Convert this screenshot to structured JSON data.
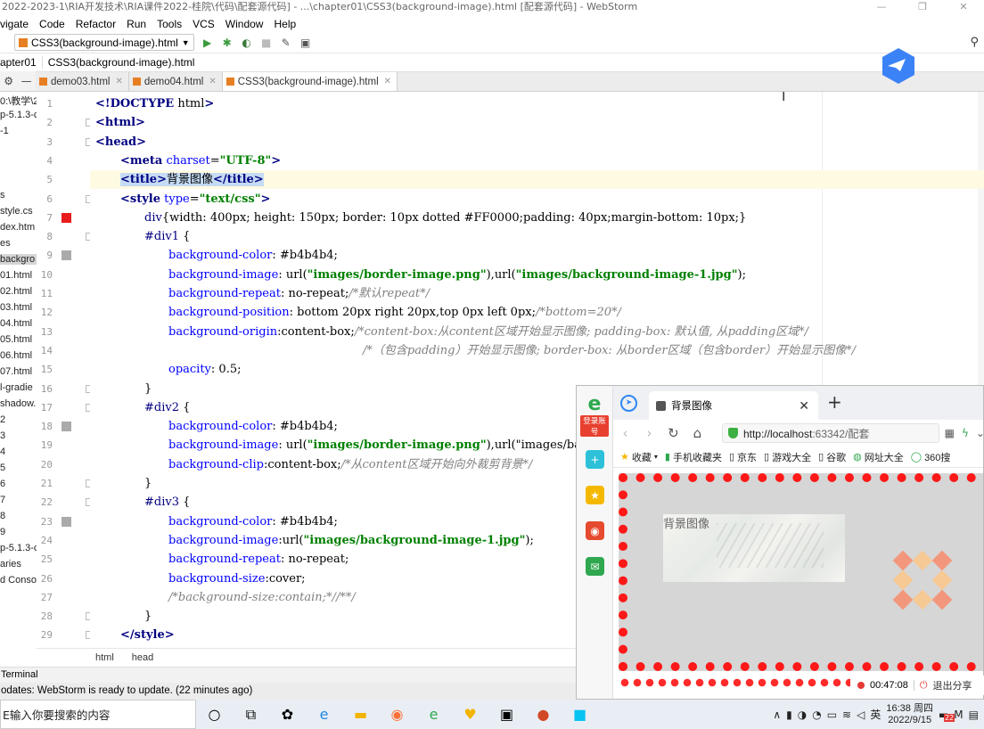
{
  "window": {
    "title": "2022-2023-1\\RIA开发技术\\RIA课件2022-桂院\\代码\\配套源代码] - ...\\chapter01\\CSS3(background-image).html [配套源代码] - WebStorm"
  },
  "menu": [
    "vigate",
    "Code",
    "Refactor",
    "Run",
    "Tools",
    "VCS",
    "Window",
    "Help"
  ],
  "toolbar": {
    "run_config": "CSS3(background-image).html"
  },
  "nav": {
    "crumb1": "apter01",
    "crumb2": "CSS3(background-image).html"
  },
  "editor_tabs": [
    {
      "label": "demo03.html"
    },
    {
      "label": "demo04.html"
    },
    {
      "label": "CSS3(background-image).html"
    }
  ],
  "project_tree": [
    "0:\\教学\\2",
    "p-5.1.3-c",
    "-1",
    "s",
    "style.cs",
    "dex.htm",
    "es",
    "backgro",
    "01.html",
    "02.html",
    "03.html",
    "04.html",
    "05.html",
    "06.html",
    "07.html",
    "l-gradie",
    "shadow.h",
    "2",
    "3",
    "4",
    "5",
    "6",
    "7",
    "8",
    "9",
    "p-5.1.3-c",
    "aries",
    "d Conso"
  ],
  "code_lines": [
    "<!DOCTYPE html>",
    "<html>",
    "<head>",
    "<meta charset=\"UTF-8\">",
    "<title>背景图像</title>",
    "<style type=\"text/css\">",
    "div{width: 400px; height: 150px; border: 10px dotted #FF0000;padding: 40px;margin-bottom: 10px;}",
    "#div1 {",
    "background-color: #b4b4b4;",
    "background-image: url(\"images/border-image.png\"),url(\"images/background-image-1.jpg\");",
    "background-repeat: no-repeat;/*默认repeat*/",
    "background-position: bottom 20px right 20px,top 0px left 0px;/*bottom=20*/",
    "background-origin:content-box;/*content-box:从content区域开始显示图像; padding-box: 默认值, 从padding区域*/",
    "/*（包含padding）开始显示图像; border-box: 从border区域（包含border）开始显示图像*/",
    "opacity: 0.5;",
    "}",
    "#div2 {",
    "background-color: #b4b4b4;",
    "background-image: url(\"images/border-image.png\"),url(\"images/ba",
    "background-clip:content-box;/*从content区域开始向外裁剪背景*/",
    "}",
    "#div3 {",
    "background-color: #b4b4b4;",
    "background-image:url(\"images/background-image-1.jpg\");",
    "background-repeat: no-repeat;",
    "background-size:cover;",
    "/*background-size:contain;*//**/",
    "}",
    "</style>"
  ],
  "line_numbers": [
    "1",
    "2",
    "3",
    "4",
    "5",
    "6",
    "7",
    "8",
    "9",
    "10",
    "11",
    "12",
    "13",
    "14",
    "15",
    "16",
    "17",
    "18",
    "19",
    "20",
    "21",
    "22",
    "23",
    "24",
    "25",
    "26",
    "27",
    "28",
    "29"
  ],
  "breadcrumb": [
    "html",
    "head"
  ],
  "terminal_label": "Terminal",
  "status_text": "odates: WebStorm is ready to update. (22 minutes ago)",
  "browser": {
    "login_badge": "登录账号",
    "tab_title": "背景图像",
    "url_host": "http://localhost",
    "url_rest": ":63342/配套",
    "bookmarks": [
      "收藏",
      "手机收藏夹",
      "京东",
      "游戏大全",
      "谷歌",
      "网址大全",
      "360搜"
    ],
    "page_text": "背景图像"
  },
  "recording": {
    "time": "00:47:08",
    "exit_label": "退出分享"
  },
  "taskbar": {
    "search_placeholder": "E输入你要搜索的内容",
    "time": "16:38 周四",
    "date": "2022/9/15",
    "ime": "英",
    "badge": "22"
  },
  "colors": {
    "tag": "#000080",
    "attr": "#0000ff",
    "string": "#008000",
    "comment": "#808080",
    "demo_border": "#FF0000",
    "demo_bg": "#b4b4b4"
  }
}
